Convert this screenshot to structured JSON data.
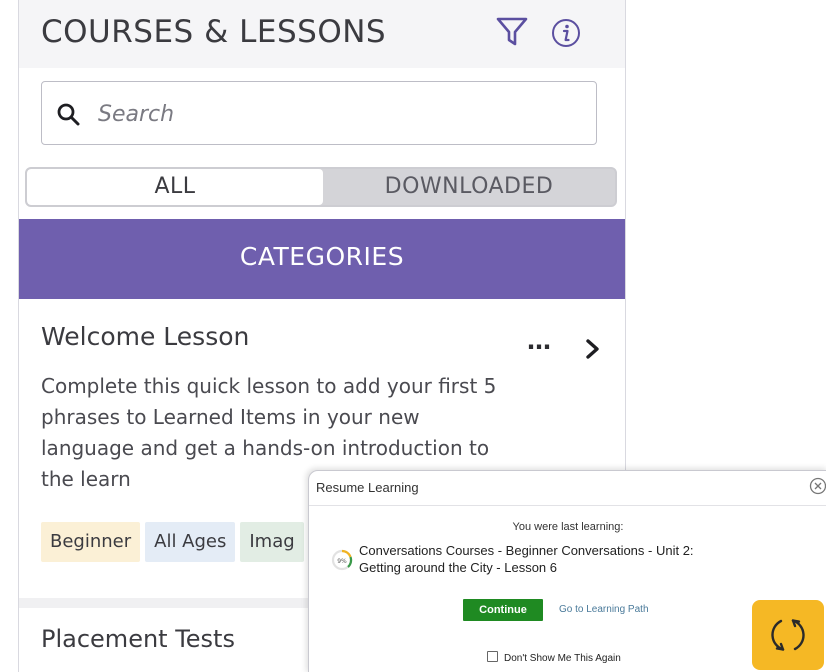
{
  "header": {
    "title": "COURSES & LESSONS",
    "filter_icon": "filter-icon",
    "info_icon": "info-icon"
  },
  "search": {
    "placeholder": "Search",
    "value": ""
  },
  "segmented": {
    "all_label": "ALL",
    "downloaded_label": "DOWNLOADED",
    "selected": "ALL"
  },
  "categories": {
    "label": "CATEGORIES"
  },
  "lesson": {
    "title": "Welcome Lesson",
    "more_label": "…",
    "description": "Complete this quick lesson to add your first 5 phrases to Learned Items in your new language and get a hands-on introduction to the learn",
    "tags": [
      "Beginner",
      "All Ages",
      "Imag"
    ]
  },
  "next_section": {
    "title": "Placement Tests"
  },
  "popup": {
    "title": "Resume Learning",
    "last_learning": "You were last learning:",
    "course_line1": "Conversations Courses - Beginner Conversations - Unit 2:",
    "course_line2": "Getting around the City - Lesson 6",
    "continue_label": "Continue",
    "path_label": "Go to Learning Path",
    "dont_show_label": "Don't Show Me This Again"
  },
  "colors": {
    "accent_purple": "#6f5fae",
    "continue_green": "#1f8a22",
    "sync_yellow": "#f5b825"
  }
}
